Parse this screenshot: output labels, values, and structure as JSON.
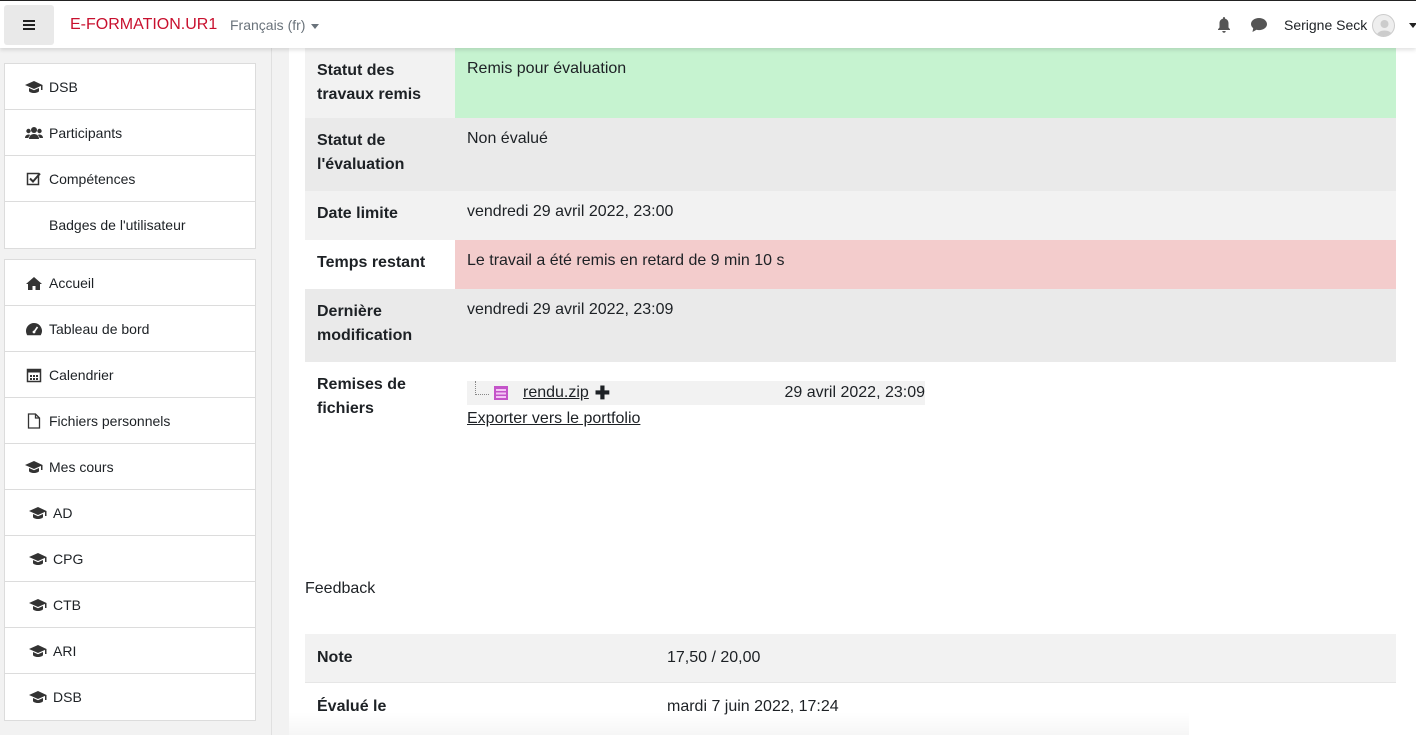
{
  "navbar": {
    "brand": "E-FORMATION.UR1",
    "language": "Français (fr)",
    "username": "Serigne Seck"
  },
  "sidebar": {
    "course_nav": [
      {
        "label": "DSB",
        "icon": "graduation-cap-icon"
      },
      {
        "label": "Participants",
        "icon": "users-icon"
      },
      {
        "label": "Compétences",
        "icon": "checkbox-icon"
      },
      {
        "label": "Badges de l'utilisateur",
        "icon": ""
      }
    ],
    "site_nav": [
      {
        "label": "Accueil",
        "icon": "home-icon"
      },
      {
        "label": "Tableau de bord",
        "icon": "dashboard-icon"
      },
      {
        "label": "Calendrier",
        "icon": "calendar-icon"
      },
      {
        "label": "Fichiers personnels",
        "icon": "file-icon"
      },
      {
        "label": "Mes cours",
        "icon": "graduation-cap-icon"
      },
      {
        "label": "AD",
        "icon": "graduation-cap-icon"
      },
      {
        "label": "CPG",
        "icon": "graduation-cap-icon"
      },
      {
        "label": "CTB",
        "icon": "graduation-cap-icon"
      },
      {
        "label": "ARI",
        "icon": "graduation-cap-icon"
      },
      {
        "label": "DSB",
        "icon": "graduation-cap-icon"
      }
    ]
  },
  "submission": {
    "rows": [
      {
        "label": "Statut des travaux remis",
        "value": "Remis pour évaluation",
        "status_color": "#c6f3d0"
      },
      {
        "label": "Statut de l'évaluation",
        "value": "Non évalué"
      },
      {
        "label": "Date limite",
        "value": "vendredi 29 avril 2022, 23:00"
      },
      {
        "label": "Temps restant",
        "value": "Le travail a été remis en retard de 9 min 10 s",
        "status_color": "#f3cccc"
      },
      {
        "label": "Dernière modification",
        "value": "vendredi 29 avril 2022, 23:09"
      },
      {
        "label": "Remises de fichiers",
        "value": ""
      }
    ],
    "file": {
      "name": "rendu.zip",
      "date": "29 avril 2022, 23:09",
      "plus": "✚",
      "export_label": "Exporter vers le portfolio"
    }
  },
  "feedback": {
    "title": "Feedback",
    "rows": [
      {
        "label": "Note",
        "value": "17,50 / 20,00"
      },
      {
        "label": "Évalué le",
        "value": "mardi 7 juin 2022, 17:24"
      }
    ]
  }
}
